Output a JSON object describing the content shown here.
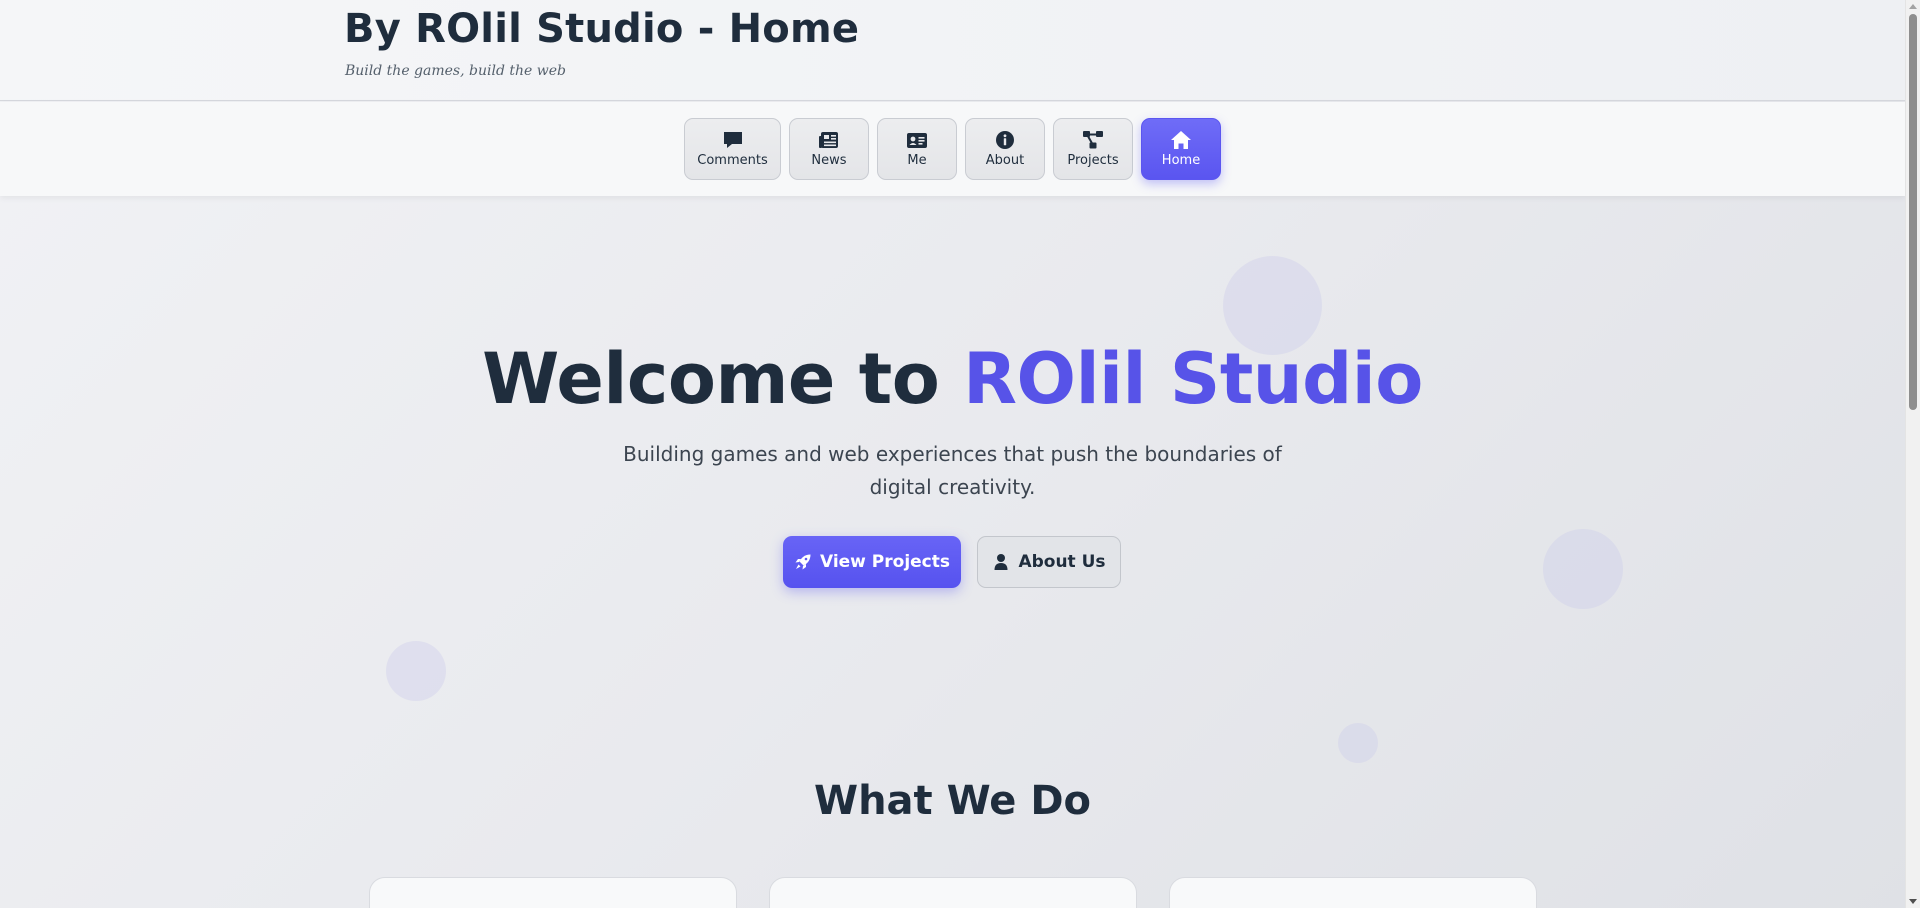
{
  "header": {
    "title": "By ROlil Studio - Home",
    "tagline": "Build the games, build the web"
  },
  "nav": {
    "items": [
      {
        "label": "Comments",
        "icon": "comment-icon"
      },
      {
        "label": "News",
        "icon": "newspaper-icon"
      },
      {
        "label": "Me",
        "icon": "id-card-icon"
      },
      {
        "label": "About",
        "icon": "info-circle-icon"
      },
      {
        "label": "Projects",
        "icon": "project-diagram-icon"
      },
      {
        "label": "Home",
        "icon": "home-icon",
        "active": true
      }
    ]
  },
  "hero": {
    "title_prefix": "Welcome to",
    "title_accent": "ROlil Studio",
    "subtitle": "Building games and web experiences that push the boundaries of digital creativity.",
    "primary_button": {
      "label": "View Projects",
      "icon": "rocket-icon"
    },
    "secondary_button": {
      "label": "About Us",
      "icon": "user-icon"
    }
  },
  "section": {
    "title": "What We Do"
  },
  "colors": {
    "accent": "#5753e8",
    "text": "#1f2d3d",
    "button_primary": "#5e5af2"
  }
}
